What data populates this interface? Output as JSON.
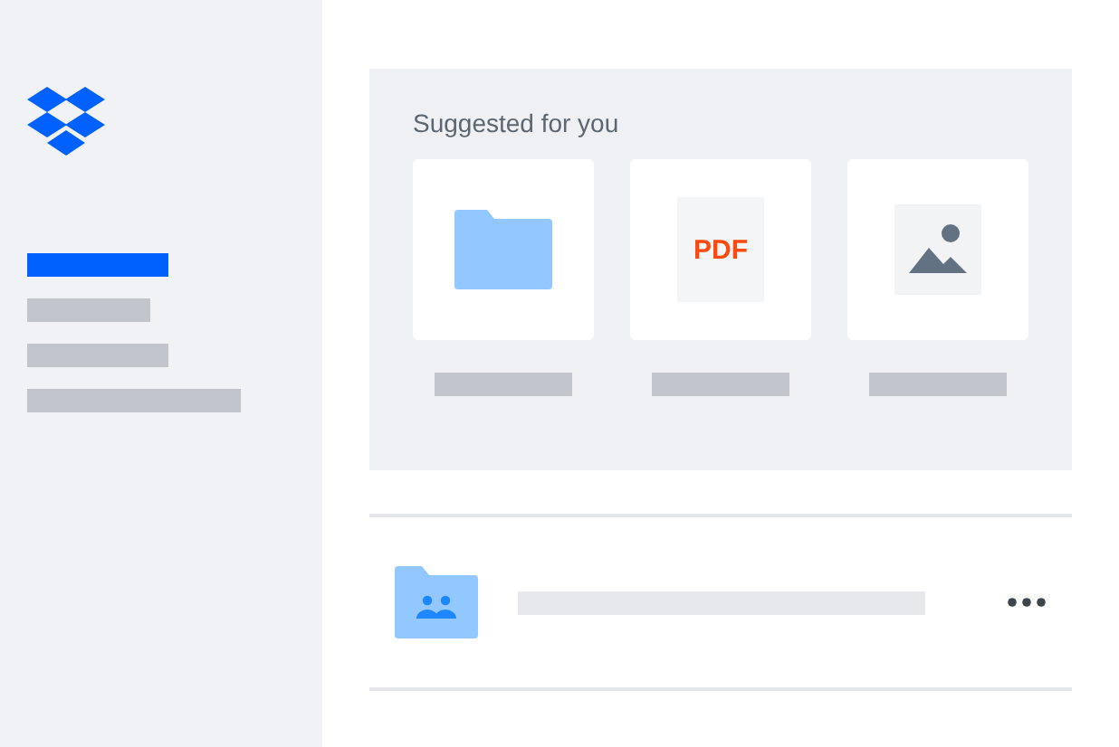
{
  "sidebar": {
    "nav_items": [
      {
        "selected": true
      },
      {
        "selected": false
      },
      {
        "selected": false
      },
      {
        "selected": false
      }
    ]
  },
  "suggested": {
    "title": "Suggested for you",
    "items": [
      {
        "kind": "folder"
      },
      {
        "kind": "pdf",
        "label": "PDF"
      },
      {
        "kind": "image"
      }
    ]
  },
  "files": [
    {
      "kind": "shared-folder"
    }
  ]
}
